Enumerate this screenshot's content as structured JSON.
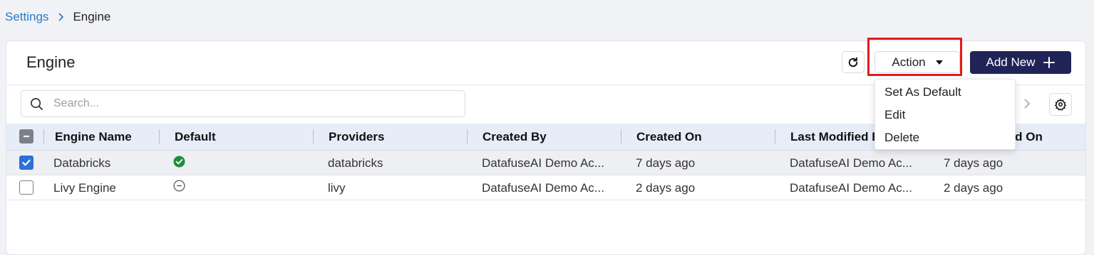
{
  "breadcrumb": {
    "link": "Settings",
    "current": "Engine"
  },
  "header": {
    "title": "Engine",
    "action_label": "Action",
    "add_new_label": "Add New"
  },
  "search": {
    "placeholder": "Search...",
    "value": ""
  },
  "table": {
    "columns": [
      "Engine Name",
      "Default",
      "Providers",
      "Created By",
      "Created On",
      "Last Modified By",
      "Last Modified On"
    ],
    "rows": [
      {
        "checked": true,
        "engine_name": "Databricks",
        "default_status": "default",
        "providers": "databricks",
        "created_by": "DatafuseAI Demo Ac...",
        "created_on": "7 days ago",
        "last_modified_by": "DatafuseAI Demo Ac...",
        "last_modified_on": "7 days ago"
      },
      {
        "checked": false,
        "engine_name": "Livy Engine",
        "default_status": "not-default",
        "providers": "livy",
        "created_by": "DatafuseAI Demo Ac...",
        "created_on": "2 days ago",
        "last_modified_by": "DatafuseAI Demo Ac...",
        "last_modified_on": "2 days ago"
      }
    ]
  },
  "dropdown": {
    "items": [
      "Set As Default",
      "Edit",
      "Delete"
    ]
  },
  "icons": {
    "breadcrumb_separator": "chevron-right-icon",
    "refresh": "refresh-icon",
    "action_caret": "caret-down-icon",
    "add": "plus-icon",
    "search": "search-icon",
    "next_page": "chevron-right-icon",
    "settings": "gear-icon",
    "default_yes": "check-circle-icon",
    "default_no": "minus-circle-icon"
  },
  "colors": {
    "primary_dark": "#1f2356",
    "link": "#2b78c5",
    "checkbox_checked": "#2e6fd8",
    "success": "#1e8f3a",
    "highlight": "#e31b1b",
    "header_bg": "#e6edf9"
  }
}
